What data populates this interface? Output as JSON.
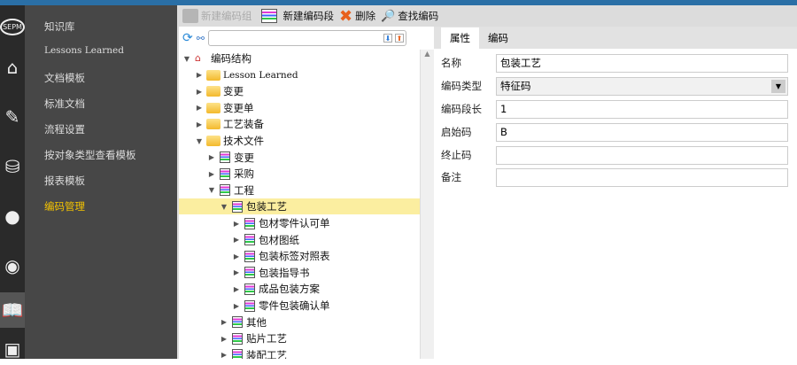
{
  "rail": {
    "icons": [
      "sepm-logo-icon",
      "home-icon",
      "edit-icon",
      "database-settings-icon",
      "chat-icon",
      "user-badge-icon",
      "book-icon",
      "contact-card-icon"
    ],
    "logo_text": "SEPM"
  },
  "menu": {
    "items": [
      "知识库",
      "Lessons Learned",
      "文档模板",
      "标准文档",
      "流程设置",
      "按对象类型查看模板",
      "报表模板",
      "编码管理"
    ],
    "active": "编码管理"
  },
  "toolbar": {
    "new_group": "新建编码组",
    "new_segment": "新建编码段",
    "delete": "删除",
    "find": "查找编码"
  },
  "search": {
    "value": "",
    "placeholder": ""
  },
  "tree": [
    {
      "label": "编码结构",
      "level": 0,
      "icon": "home",
      "open": true
    },
    {
      "label": "Lesson Learned",
      "level": 1,
      "icon": "folder",
      "open": false
    },
    {
      "label": "变更",
      "level": 1,
      "icon": "folder",
      "open": false
    },
    {
      "label": "变更单",
      "level": 1,
      "icon": "folder",
      "open": false
    },
    {
      "label": "工艺装备",
      "level": 1,
      "icon": "folder",
      "open": false
    },
    {
      "label": "技术文件",
      "level": 1,
      "icon": "folder",
      "open": true
    },
    {
      "label": "变更",
      "level": 2,
      "icon": "doc",
      "open": false
    },
    {
      "label": "采购",
      "level": 2,
      "icon": "doc",
      "open": false
    },
    {
      "label": "工程",
      "level": 2,
      "icon": "doc",
      "open": true
    },
    {
      "label": "包装工艺",
      "level": 3,
      "icon": "doc",
      "open": true,
      "selected": true
    },
    {
      "label": "包材零件认可单",
      "level": 4,
      "icon": "doc",
      "open": false
    },
    {
      "label": "包材图纸",
      "level": 4,
      "icon": "doc",
      "open": false
    },
    {
      "label": "包装标签对照表",
      "level": 4,
      "icon": "doc",
      "open": false
    },
    {
      "label": "包装指导书",
      "level": 4,
      "icon": "doc",
      "open": false
    },
    {
      "label": "成品包装方案",
      "level": 4,
      "icon": "doc",
      "open": false
    },
    {
      "label": "零件包装确认单",
      "level": 4,
      "icon": "doc",
      "open": false
    },
    {
      "label": "其他",
      "level": 3,
      "icon": "doc",
      "open": false
    },
    {
      "label": "贴片工艺",
      "level": 3,
      "icon": "doc",
      "open": false
    },
    {
      "label": "装配工艺",
      "level": 3,
      "icon": "doc",
      "open": false
    }
  ],
  "tabs": [
    "属性",
    "编码"
  ],
  "form": {
    "name_label": "名称",
    "name": "包装工艺",
    "type_label": "编码类型",
    "type": "特征码",
    "length_label": "编码段长",
    "length": "1",
    "start_label": "启始码",
    "start": "B",
    "end_label": "终止码",
    "end": "",
    "note_label": "备注",
    "note": ""
  },
  "colors": {
    "accent": "#2a6fa6",
    "active_menu": "#f5c400",
    "selected_row": "#fbeea0"
  }
}
